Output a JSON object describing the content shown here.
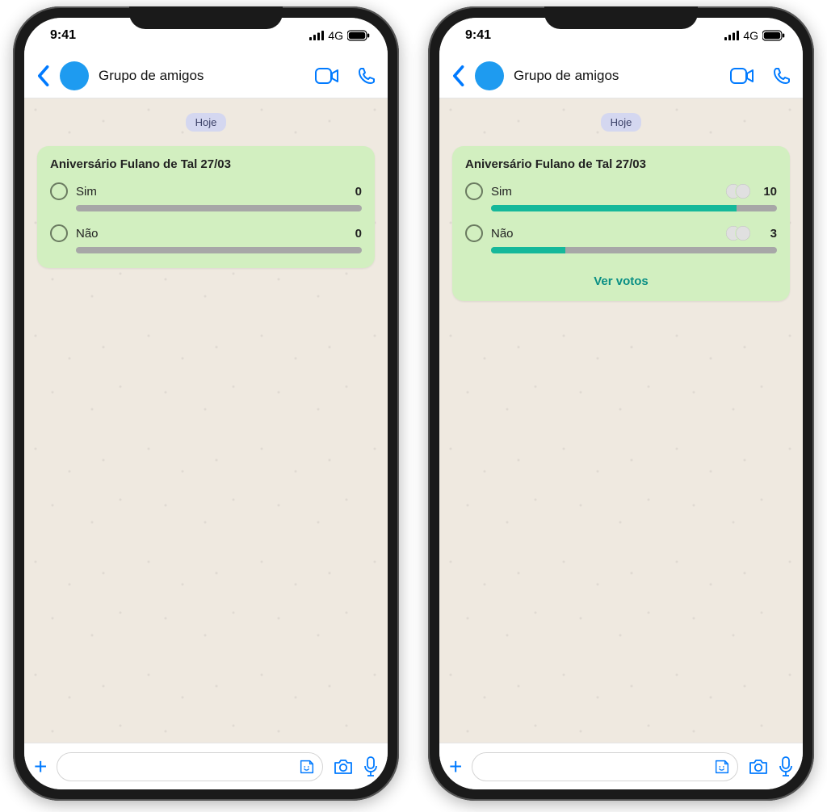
{
  "status": {
    "time": "9:41",
    "network": "4G"
  },
  "header": {
    "chat_name": "Grupo de amigos"
  },
  "body": {
    "date_label": "Hoje",
    "poll_title": "Aniversário Fulano de Tal 27/03"
  },
  "phone1": {
    "options": [
      {
        "label": "Sim",
        "count": "0",
        "fill_pct": 0,
        "show_avatars": false
      },
      {
        "label": "Não",
        "count": "0",
        "fill_pct": 0,
        "show_avatars": false
      }
    ],
    "show_see_votes": false
  },
  "phone2": {
    "options": [
      {
        "label": "Sim",
        "count": "10",
        "fill_pct": 86,
        "show_avatars": true
      },
      {
        "label": "Não",
        "count": "3",
        "fill_pct": 26,
        "show_avatars": true
      }
    ],
    "see_votes_label": "Ver votos",
    "show_see_votes": true
  }
}
